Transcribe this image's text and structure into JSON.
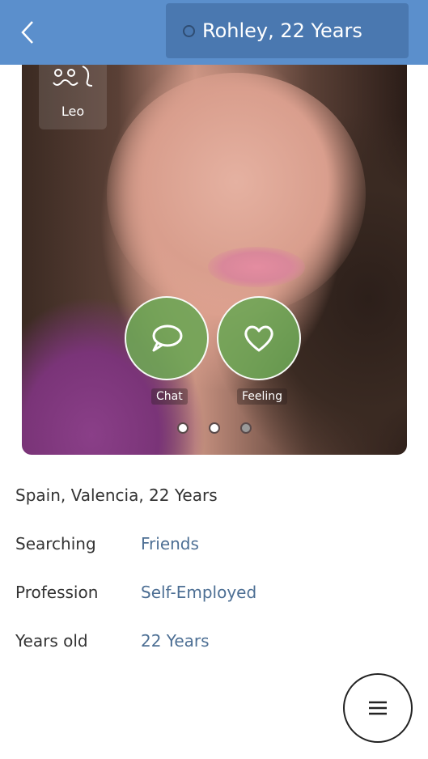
{
  "header": {
    "back_icon": "chevron-left-icon",
    "title": "Rohley, 22 Years",
    "status_icon": "status-circle-icon"
  },
  "photo": {
    "zodiac": {
      "icon": "leo-zodiac-icon",
      "label": "Leo"
    },
    "actions": [
      {
        "icon": "chat-bubble-icon",
        "label": "Chat"
      },
      {
        "icon": "heart-icon",
        "label": "Feeling"
      }
    ],
    "carousel": {
      "count": 3,
      "active_index": 2
    }
  },
  "profile": {
    "location": "Spain, Valencia, 22 Years",
    "rows": [
      {
        "label": "Searching",
        "value": "Friends"
      },
      {
        "label": "Profession",
        "value": "Self-Employed"
      },
      {
        "label": "Years old",
        "value": "22 Years"
      }
    ]
  },
  "fab": {
    "icon": "menu-icon"
  },
  "colors": {
    "topbar": "#5b8fcc",
    "pill": "#4a78b0",
    "value_text": "#4d6f94",
    "action_green": "#6ea555"
  }
}
